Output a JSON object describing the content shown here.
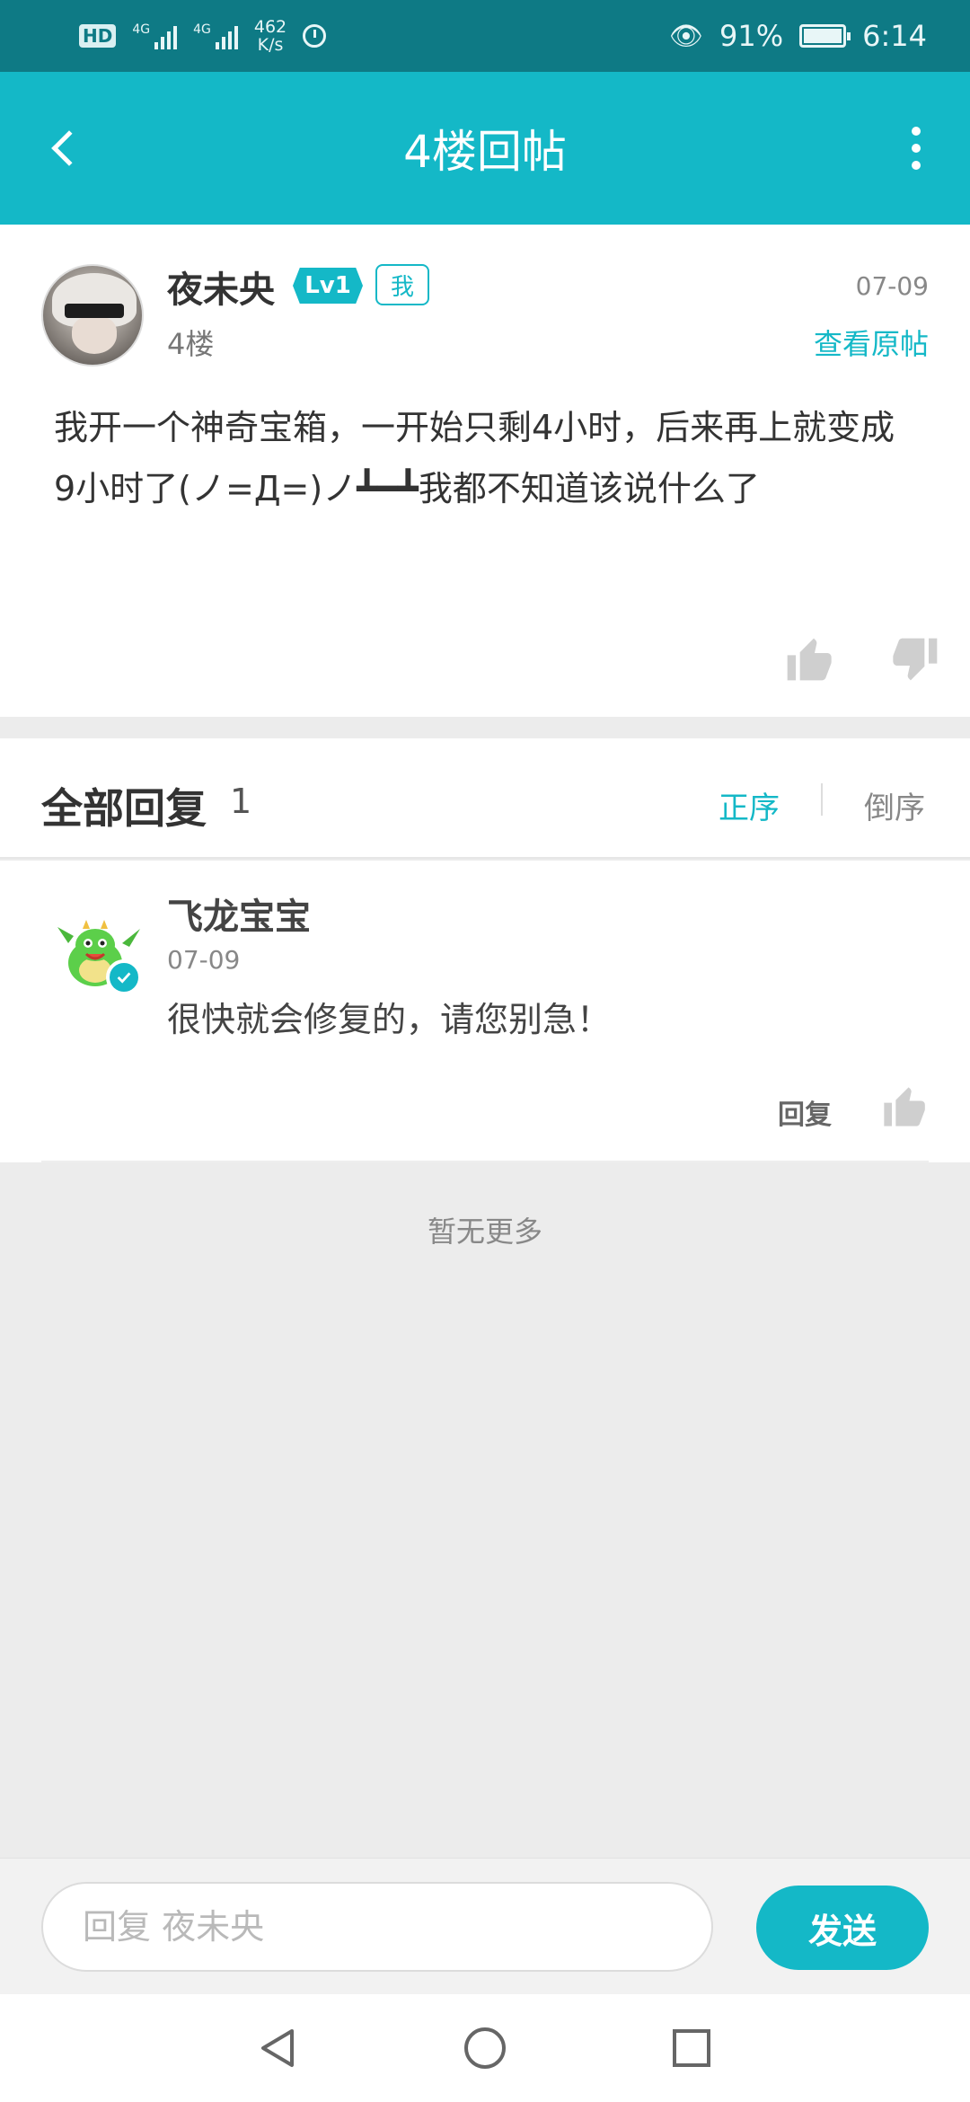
{
  "status_bar": {
    "hd": "HD",
    "sim1_tag": "4G",
    "sim2_tag": "4G",
    "net_speed_value": "462",
    "net_speed_unit": "K/s",
    "battery_percent": "91%",
    "time": "6:14"
  },
  "app_bar": {
    "title": "4楼回帖"
  },
  "post": {
    "author": "夜未央",
    "level": "Lv1",
    "me_badge": "我",
    "floor": "4楼",
    "date": "07-09",
    "view_original": "查看原帖",
    "content": "我开一个神奇宝箱，一开始只剩4小时，后来再上就变成9小时了(ノ=Д=)ノ┻━┻我都不知道该说什么了"
  },
  "replies_section": {
    "title": "全部回复",
    "count": "1",
    "sort_asc": "正序",
    "sort_desc": "倒序"
  },
  "replies": [
    {
      "author": "飞龙宝宝",
      "date": "07-09",
      "content": "很快就会修复的，请您别急！",
      "reply_label": "回复"
    }
  ],
  "no_more": "暂无更多",
  "input_bar": {
    "placeholder": "回复 夜未央",
    "send_label": "发送"
  },
  "colors": {
    "accent": "#14b8c7",
    "status_bar": "#0e7a85",
    "background": "#ececec"
  },
  "icons": [
    "back-arrow-icon",
    "more-vertical-icon",
    "thumbs-up-icon",
    "thumbs-down-icon",
    "verified-check-icon",
    "nav-back-icon",
    "nav-home-icon",
    "nav-recents-icon"
  ]
}
